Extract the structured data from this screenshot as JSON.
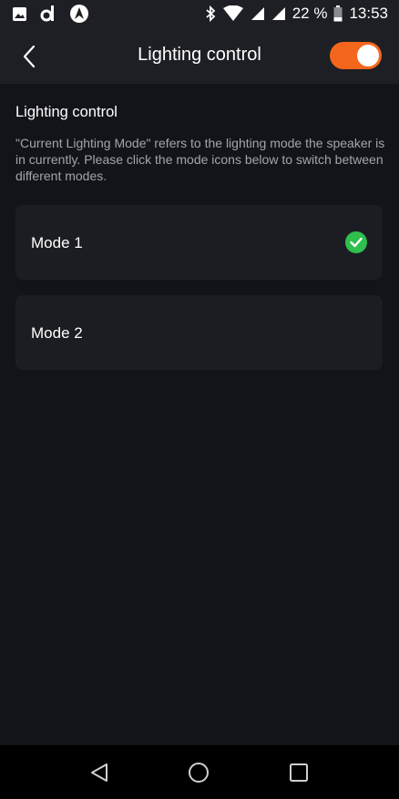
{
  "status_bar": {
    "battery_text": "22 %",
    "time": "13:53",
    "left_icons": [
      "image-icon",
      "d-app-icon",
      "gauge-app-icon"
    ],
    "right_icons": [
      "bluetooth-icon",
      "wifi-icon",
      "signal-icon",
      "signal-icon",
      "battery-icon"
    ]
  },
  "header": {
    "title": "Lighting control",
    "toggle_on": true,
    "accent_color": "#f4661b"
  },
  "content": {
    "section_title": "Lighting control",
    "description": "\"Current Lighting Mode\" refers to the lighting mode the speaker is in currently. Please click the mode icons below to switch between different modes.",
    "modes": [
      {
        "label": "Mode 1",
        "selected": true
      },
      {
        "label": "Mode 2",
        "selected": false
      }
    ],
    "selected_color": "#2fbf4e"
  },
  "nav_bar": {
    "buttons": [
      "back-triangle-icon",
      "home-circle-icon",
      "recents-square-icon"
    ]
  }
}
